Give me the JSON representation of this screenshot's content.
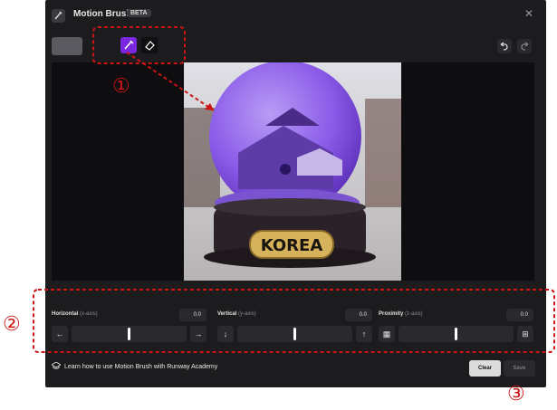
{
  "header": {
    "title": "Motion Brush",
    "badge": "BETA",
    "close_icon": "close-icon"
  },
  "toolbar": {
    "brush_icon": "brush-icon",
    "eraser_icon": "eraser-icon",
    "undo_icon": "undo-icon",
    "redo_icon": "redo-icon"
  },
  "canvas": {
    "snow_globe_text": "KOREA"
  },
  "controls": [
    {
      "label": "Horizontal",
      "axis": "(x-axis)",
      "value": "0.0",
      "left_icon": "arrow-left-icon",
      "right_icon": "arrow-right-icon",
      "level": 0.5
    },
    {
      "label": "Vertical",
      "axis": "(y-axis)",
      "value": "0.0",
      "left_icon": "arrow-down-icon",
      "right_icon": "arrow-up-icon",
      "level": 0.5
    },
    {
      "label": "Proximity",
      "axis": "(z-axis)",
      "value": "0.0",
      "left_icon": "proximity-in-icon",
      "right_icon": "proximity-out-icon",
      "level": 0.5
    }
  ],
  "footer": {
    "link_text": "Learn how to use Motion Brush with Runway Academy",
    "clear_label": "Clear",
    "save_label": "Save"
  },
  "annotations": {
    "one": "①",
    "two": "②",
    "three": "③"
  },
  "colors": {
    "accent": "#7a28e0",
    "annotation": "#cc1414",
    "modal_bg": "#1c1c1e"
  }
}
